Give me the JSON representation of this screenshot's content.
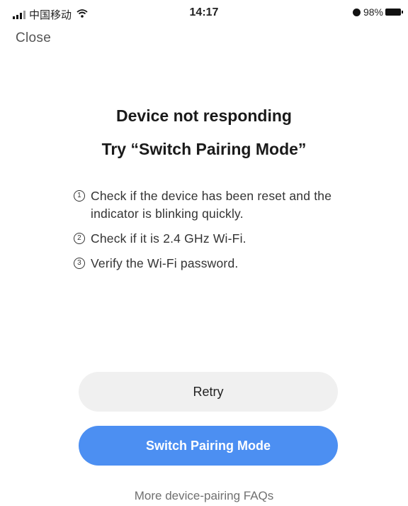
{
  "status_bar": {
    "carrier": "中国移动",
    "time": "14:17",
    "battery": "98%",
    "icons": [
      "signal-icon",
      "wifi-icon",
      "alarm-icon",
      "battery-icon"
    ]
  },
  "close_label": "Close",
  "title_line1": "Device not responding",
  "title_line2": "Try “Switch Pairing Mode”",
  "steps": [
    {
      "num": "1",
      "text": "Check if the device has been reset and the indicator is blinking quickly."
    },
    {
      "num": "2",
      "text": "Check if it is 2.4 GHz Wi-Fi."
    },
    {
      "num": "3",
      "text": "Verify the Wi-Fi password."
    }
  ],
  "retry_label": "Retry",
  "switch_label": "Switch Pairing Mode",
  "faq_label": "More device-pairing FAQs",
  "colors": {
    "primary": "#4c8ff2",
    "secondary_bg": "#f0f0f0",
    "muted_text": "#707070"
  }
}
